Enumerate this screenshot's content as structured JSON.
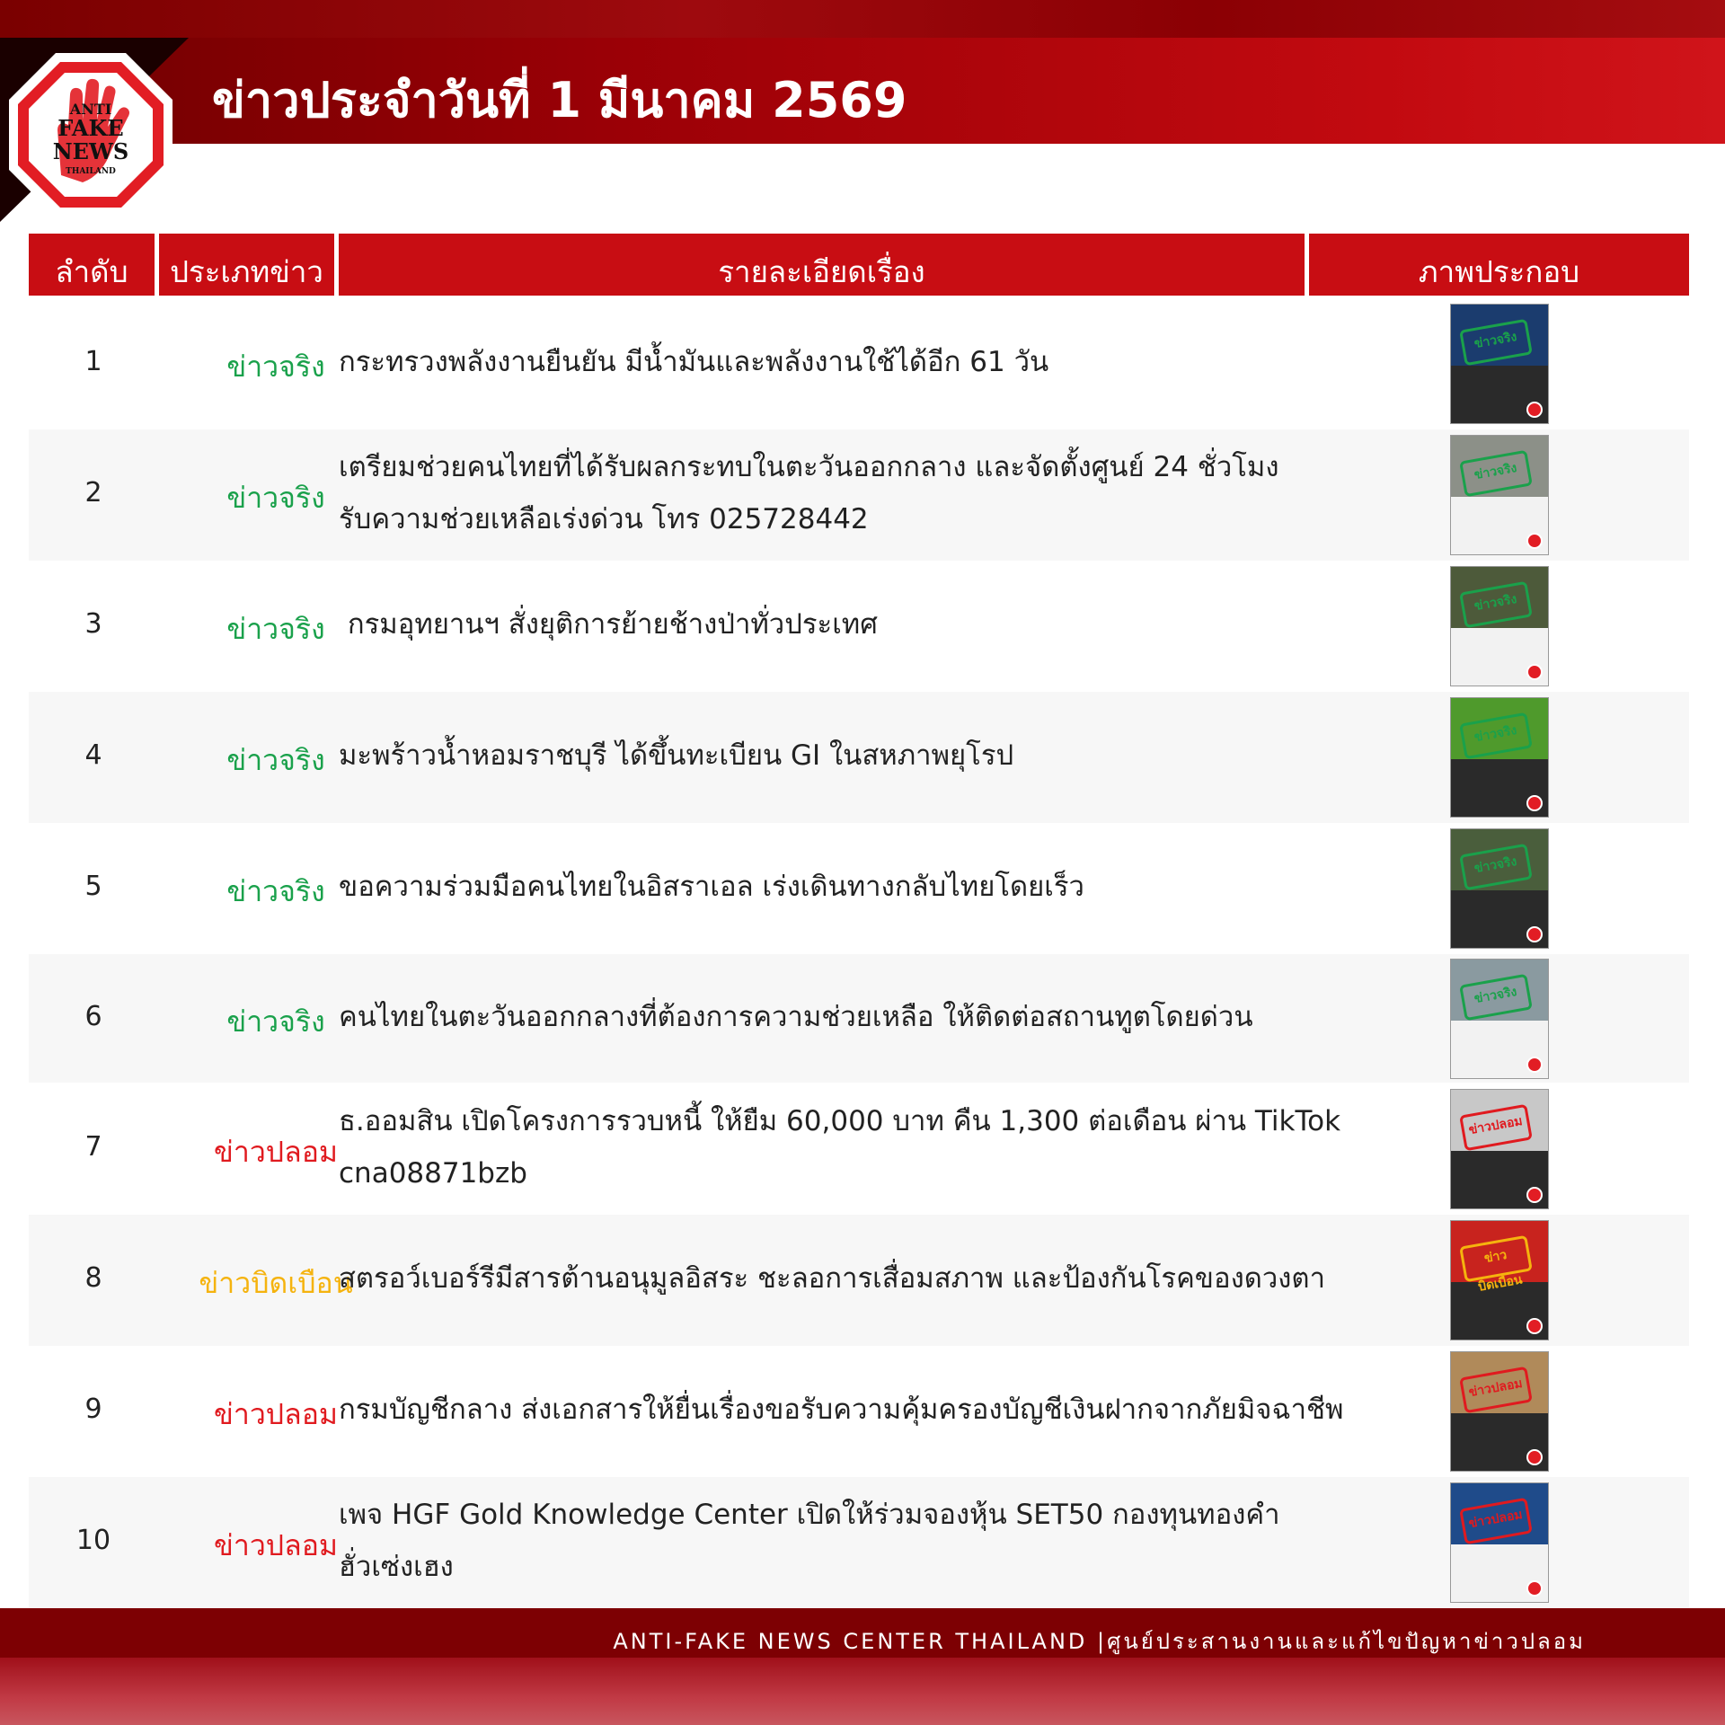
{
  "header": {
    "title": "ข่าวประจำวันที่ 1 มีนาคม 2569",
    "logo_text": {
      "line1": "ANTI",
      "line2": "FAKE",
      "line3": "NEWS",
      "line4": "THAILAND"
    }
  },
  "table": {
    "columns": [
      "ลำดับ",
      "ประเภทข่าว",
      "รายละเอียดเรื่อง",
      "ภาพประกอบ"
    ],
    "rows": [
      {
        "num": "1",
        "type": "ข่าวจริง",
        "kind": "true",
        "lines": [
          "กระทรวงพลังงานยืนยัน มีน้ำมันและพลังงานใช้ได้อีก 61 วัน"
        ]
      },
      {
        "num": "2",
        "type": "ข่าวจริง",
        "kind": "true",
        "lines": [
          "เตรียมช่วยคนไทยที่ได้รับผลกระทบในตะวันออกกลาง และจัดตั้งศูนย์ 24 ชั่วโมง",
          "รับความช่วยเหลือเร่งด่วน โทร 025728442"
        ]
      },
      {
        "num": "3",
        "type": "ข่าวจริง",
        "kind": "true",
        "lines": [
          " กรมอุทยานฯ สั่งยุติการย้ายช้างป่าทั่วประเทศ"
        ]
      },
      {
        "num": "4",
        "type": "ข่าวจริง",
        "kind": "true",
        "lines": [
          "มะพร้าวน้ำหอมราชบุรี ได้ขึ้นทะเบียน GI ในสหภาพยุโรป"
        ]
      },
      {
        "num": "5",
        "type": "ข่าวจริง",
        "kind": "true",
        "lines": [
          "ขอความร่วมมือคนไทยในอิสราเอล เร่งเดินทางกลับไทยโดยเร็ว"
        ]
      },
      {
        "num": "6",
        "type": "ข่าวจริง",
        "kind": "true",
        "lines": [
          "คนไทยในตะวันออกกลางที่ต้องการความช่วยเหลือ ให้ติดต่อสถานทูตโดยด่วน"
        ]
      },
      {
        "num": "7",
        "type": "ข่าวปลอม",
        "kind": "fake",
        "lines": [
          "ธ.ออมสิน เปิดโครงการรวบหนี้ ให้ยืม 60,000 บาท คืน 1,300 ต่อเดือน ผ่าน TikTok",
          "cna08871bzb"
        ]
      },
      {
        "num": "8",
        "type": "ข่าวบิดเบือน",
        "kind": "distort",
        "lines": [
          "สตรอว์เบอร์รีมีสารต้านอนุมูลอิสระ ชะลอการเสื่อมสภาพ และป้องกันโรคของดวงตา"
        ]
      },
      {
        "num": "9",
        "type": "ข่าวปลอม",
        "kind": "fake",
        "lines": [
          "กรมบัญชีกลาง ส่งเอกสารให้ยื่นเรื่องขอรับความคุ้มครองบัญชีเงินฝากจากภัยมิจฉาชีพ"
        ]
      },
      {
        "num": "10",
        "type": "ข่าวปลอม",
        "kind": "fake",
        "lines": [
          "เพจ HGF Gold Knowledge Center เปิดให้ร่วมจองหุ้น SET50 กองทุนทองคำ",
          "ฮั่วเซ่งเฮง"
        ]
      }
    ]
  },
  "thumbnails": [
    {
      "stamp": "ข่าวจริง",
      "stamp_color": "#1aa14b",
      "bg": "#1b3c6e",
      "accent": "#2a2a2a"
    },
    {
      "stamp": "ข่าวจริง",
      "stamp_color": "#1aa14b",
      "bg": "#8c9088",
      "accent": "#f2f2f2"
    },
    {
      "stamp": "ข่าวจริง",
      "stamp_color": "#1aa14b",
      "bg": "#4d5a3a",
      "accent": "#f2f2f2"
    },
    {
      "stamp": "ข่าวจริง",
      "stamp_color": "#1aa14b",
      "bg": "#4f9a2c",
      "accent": "#2a2a2a"
    },
    {
      "stamp": "ข่าวจริง",
      "stamp_color": "#1aa14b",
      "bg": "#4a5e3c",
      "accent": "#2a2a2a"
    },
    {
      "stamp": "ข่าวจริง",
      "stamp_color": "#1aa14b",
      "bg": "#8a9aa0",
      "accent": "#f2f2f2"
    },
    {
      "stamp": "ข่าวปลอม",
      "stamp_color": "#e01a1f",
      "bg": "#c8c8c8",
      "accent": "#2a2a2a"
    },
    {
      "stamp": "ข่าวบิดเบือน",
      "stamp_color": "#f5b30e",
      "bg": "#c8231e",
      "accent": "#2a2a2a"
    },
    {
      "stamp": "ข่าวปลอม",
      "stamp_color": "#e01a1f",
      "bg": "#b08a5a",
      "accent": "#2a2a2a"
    },
    {
      "stamp": "ข่าวปลอม",
      "stamp_color": "#e01a1f",
      "bg": "#1f4b8a",
      "accent": "#f2f2f2"
    }
  ],
  "footer": {
    "text": "ANTI-FAKE NEWS CENTER THAILAND |ศูนย์ประสานงานและแก้ไขปัญหาข่าวปลอม"
  },
  "colors": {
    "header_red": "#c80d13",
    "true_green": "#1aa14b",
    "fake_red": "#e01a1f",
    "distort_yellow": "#f5b30e",
    "footer_red": "#7d0003"
  }
}
